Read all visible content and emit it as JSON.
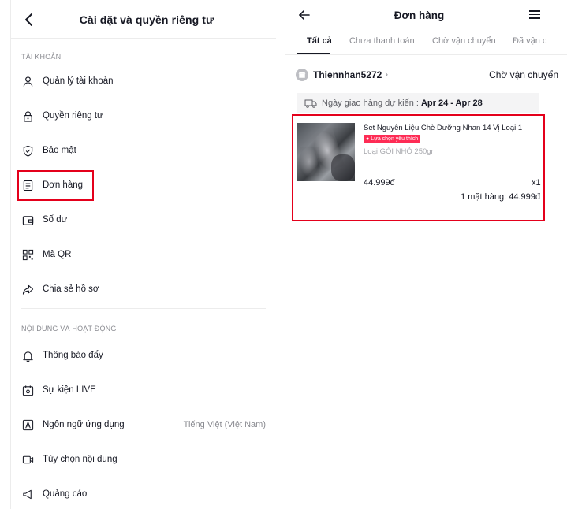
{
  "settings": {
    "title": "Cài đặt và quyền riêng tư",
    "sections": [
      {
        "label": "TÀI KHOẢN",
        "items": [
          {
            "label": "Quản lý tài khoản",
            "icon": "person-icon"
          },
          {
            "label": "Quyền riêng tư",
            "icon": "lock-icon"
          },
          {
            "label": "Bảo mật",
            "icon": "shield-icon"
          },
          {
            "label": "Đơn hàng",
            "icon": "order-icon"
          },
          {
            "label": "Số dư",
            "icon": "wallet-icon"
          },
          {
            "label": "Mã QR",
            "icon": "qr-icon"
          },
          {
            "label": "Chia sẻ hồ sơ",
            "icon": "share-icon"
          }
        ]
      },
      {
        "label": "NỘI DUNG VÀ HOẠT ĐỘNG",
        "items": [
          {
            "label": "Thông báo đẩy",
            "icon": "bell-icon"
          },
          {
            "label": "Sự kiện LIVE",
            "icon": "calendar-icon"
          },
          {
            "label": "Ngôn ngữ ứng dụng",
            "icon": "language-icon",
            "value": "Tiếng Việt (Việt Nam)"
          },
          {
            "label": "Tùy chọn nội dung",
            "icon": "video-icon"
          },
          {
            "label": "Quảng cáo",
            "icon": "megaphone-icon"
          }
        ]
      }
    ]
  },
  "orders": {
    "title": "Đơn hàng",
    "tabs": [
      "Tất cả",
      "Chưa thanh toán",
      "Chờ vận chuyển",
      "Đã vận c"
    ],
    "active_tab": 0,
    "shop": {
      "name": "Thiennhan5272",
      "status": "Chờ vận chuyển"
    },
    "delivery": {
      "label": "Ngày giao hàng dự kiến :",
      "range": "Apr 24 - Apr 28"
    },
    "product": {
      "name": "Set Nguyên Liệu Chè Dưỡng Nhan 14 Vị Loại 1",
      "badge": "Lựa chọn yêu thích",
      "variant": "Loại GÓI NHỎ 250gr",
      "price": "44.999đ",
      "quantity": "x1",
      "total": "1 mặt hàng: 44.999đ"
    }
  },
  "colors": {
    "highlight": "#e4001b",
    "badge": "#fe2c55"
  }
}
